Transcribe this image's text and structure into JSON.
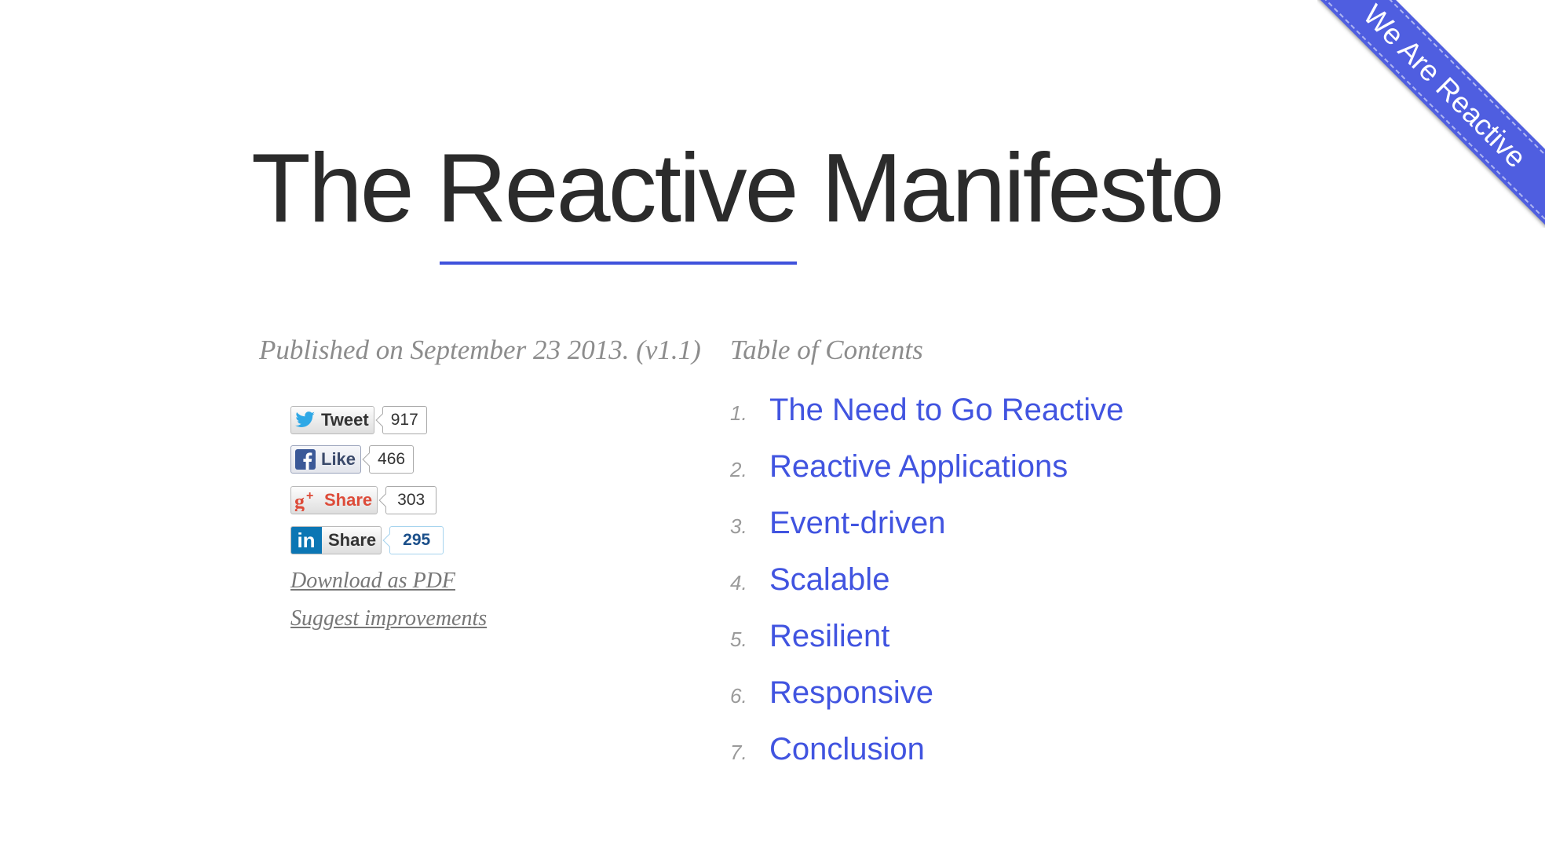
{
  "ribbon": {
    "label": "We Are Reactive"
  },
  "title": {
    "prefix": "The ",
    "highlight": "Reactive",
    "suffix": " Manifesto"
  },
  "meta": {
    "published": "Published on September 23 2013. (v1.1)"
  },
  "social": {
    "twitter": {
      "label": "Tweet",
      "count": "917"
    },
    "facebook": {
      "label": "Like",
      "count": "466"
    },
    "gplus": {
      "label": "Share",
      "count": "303"
    },
    "linkedin": {
      "label": "Share",
      "count": "295"
    }
  },
  "links": {
    "pdf": "Download as PDF",
    "suggest": "Suggest improvements"
  },
  "toc": {
    "heading": "Table of Contents",
    "items": [
      {
        "num": "1.",
        "label": "The Need to Go Reactive"
      },
      {
        "num": "2.",
        "label": "Reactive Applications"
      },
      {
        "num": "3.",
        "label": "Event-driven"
      },
      {
        "num": "4.",
        "label": "Scalable"
      },
      {
        "num": "5.",
        "label": "Resilient"
      },
      {
        "num": "6.",
        "label": "Responsive"
      },
      {
        "num": "7.",
        "label": "Conclusion"
      }
    ]
  },
  "colors": {
    "accent": "#4154e0",
    "ribbon": "#4f5ee0",
    "muted": "#8c8c8c"
  }
}
